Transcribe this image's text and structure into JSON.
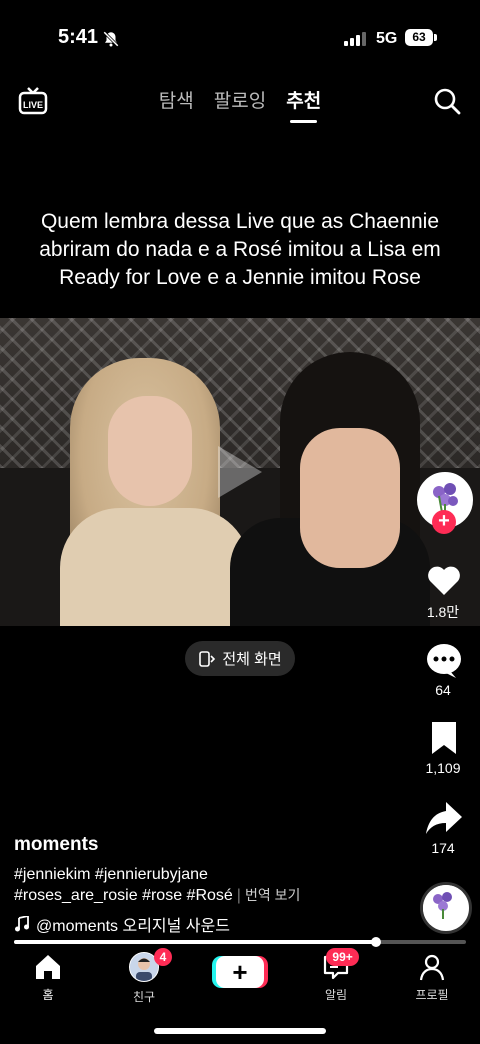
{
  "status_bar": {
    "time": "5:41",
    "network": "5G",
    "battery": "63"
  },
  "top_nav": {
    "tabs": [
      {
        "label": "탐색",
        "active": false
      },
      {
        "label": "팔로잉",
        "active": false
      },
      {
        "label": "추천",
        "active": true
      }
    ]
  },
  "video": {
    "caption": "Quem lembra dessa Live que as Chaennie abriram do nada e a Rosé imitou a Lisa em Ready for Love e a Jennie imitou Rose",
    "fullscreen_label": "전체 화면"
  },
  "actions": {
    "likes": "1.8만",
    "comments": "64",
    "saves": "1,109",
    "shares": "174"
  },
  "post": {
    "username": "moments",
    "hashtags_line1": "#jenniekim #jennierubyjane",
    "hashtags_line2": "#roses_are_rosie #rose #Rosé",
    "translate_label": "번역 보기",
    "sound": "@moments 오리지널 사운드"
  },
  "progress": 0.8,
  "bottom_nav": {
    "home": "홈",
    "friends": "친구",
    "friends_badge": "4",
    "inbox": "알림",
    "inbox_badge": "99+",
    "profile": "프로필"
  },
  "colors": {
    "accent": "#fe2c55",
    "cyan": "#25f4ee"
  }
}
